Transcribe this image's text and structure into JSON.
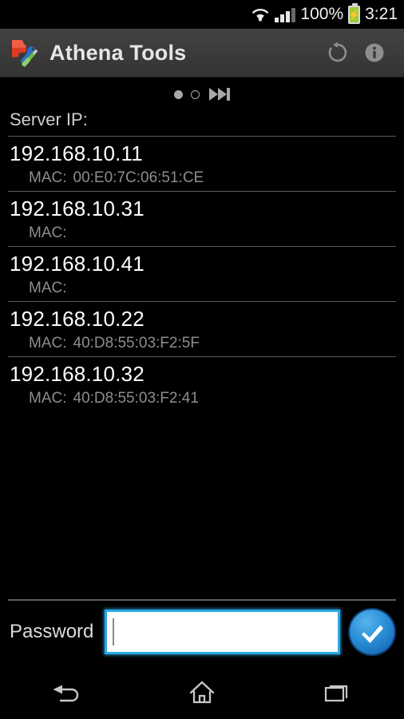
{
  "status_bar": {
    "wifi_icon": "wifi-icon",
    "signal_icon": "cellular-signal-icon",
    "battery_percent": "100%",
    "battery_icon": "battery-charging-icon",
    "time": "3:21"
  },
  "action_bar": {
    "app_icon": "puzzle-tools-app-icon",
    "title": "Athena Tools",
    "refresh_icon": "refresh-icon",
    "info_icon": "info-icon"
  },
  "page_indicator": {
    "dot_active": "page-dot-filled",
    "dot_inactive": "page-dot-hollow",
    "skip_icon": "skip-forward-icon"
  },
  "list": {
    "header": "Server IP:",
    "mac_label": "MAC:",
    "items": [
      {
        "ip": "192.168.10.11",
        "mac": "00:E0:7C:06:51:CE"
      },
      {
        "ip": "192.168.10.31",
        "mac": ""
      },
      {
        "ip": "192.168.10.41",
        "mac": ""
      },
      {
        "ip": "192.168.10.22",
        "mac": "40:D8:55:03:F2:5F"
      },
      {
        "ip": "192.168.10.32",
        "mac": "40:D8:55:03:F2:41"
      }
    ]
  },
  "password_bar": {
    "label": "Password",
    "value": "",
    "placeholder": "",
    "submit_icon": "checkmark-circle-icon"
  },
  "nav_bar": {
    "back_icon": "back-arrow-icon",
    "home_icon": "home-icon",
    "recents_icon": "recent-apps-icon"
  },
  "colors": {
    "accent_blue": "#29a9e8",
    "action_bar": "#3b3b3b",
    "divider": "#5a5a5a",
    "battery_green": "#9ccc3a"
  }
}
